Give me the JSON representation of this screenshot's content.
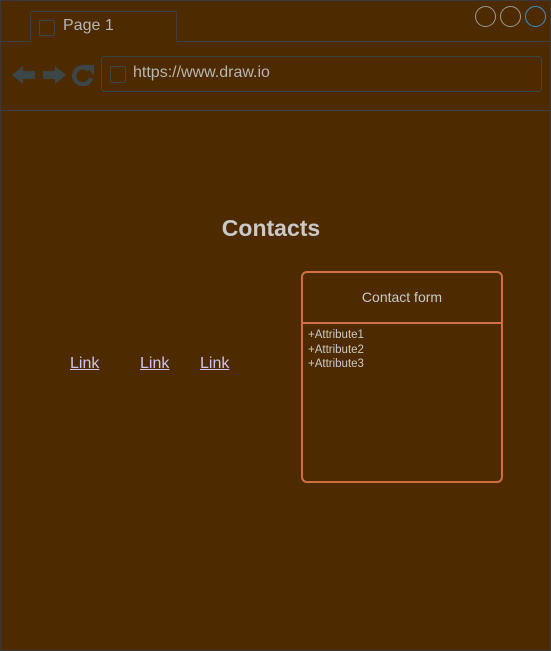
{
  "browser": {
    "tab_label": "Page 1",
    "address": "https://www.draw.io",
    "icons": {
      "back": "arrow-left-icon",
      "forward": "arrow-right-icon",
      "reload": "reload-icon",
      "page": "page-icon"
    },
    "window_buttons": [
      "minimize",
      "maximize",
      "close"
    ]
  },
  "page": {
    "heading": "Contacts",
    "links": [
      "Link",
      "Link",
      "Link"
    ],
    "form": {
      "title": "Contact form",
      "attributes": [
        "+Attribute1",
        "+Attribute2",
        "+Attribute3"
      ]
    }
  },
  "colors": {
    "background": "#4d2a00",
    "accent": "#d0703f",
    "link": "#cfc3f2",
    "text": "#c9c9c9"
  }
}
